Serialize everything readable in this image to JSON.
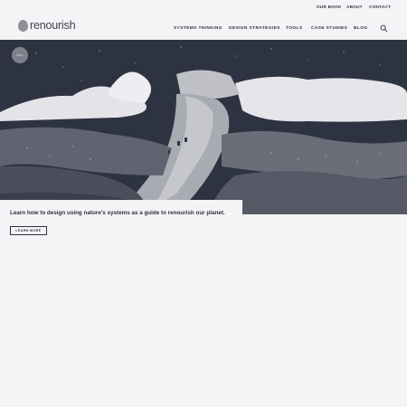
{
  "utility_nav": [
    "OUR BOOK",
    "ABOUT",
    "CONTACT"
  ],
  "brand": {
    "name_prefix": "re",
    "name_suffix": "nourish"
  },
  "main_nav": [
    "SYSTEMS THINKING",
    "DESIGN STRATEGIES",
    "TOOLS",
    "CASE STUDIES",
    "BLOG"
  ],
  "hero": {
    "badge": "Intro",
    "tagline": "Learn how to design using nature's systems as a guide to renourish our planet.",
    "cta_label": "LEARN MORE"
  },
  "colors": {
    "ink": "#2b3140",
    "page_bg": "#f6f3f6",
    "hero_dark": "#2e3342"
  }
}
